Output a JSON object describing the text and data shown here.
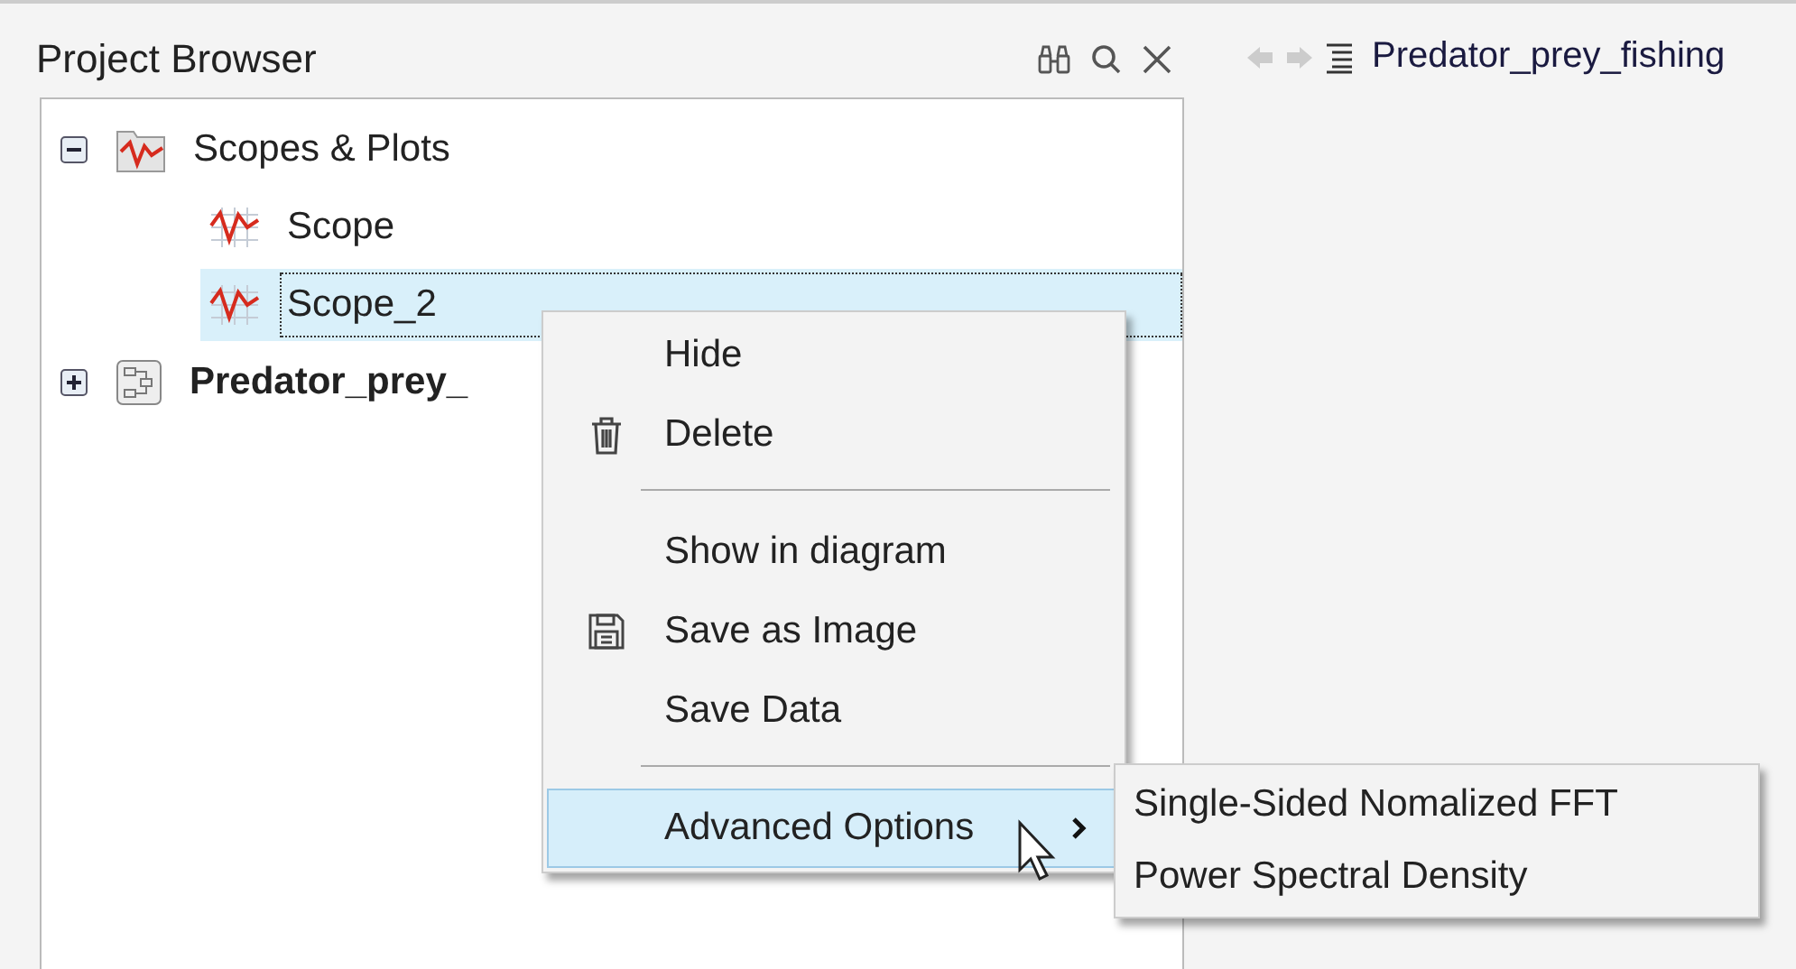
{
  "panel": {
    "title": "Project Browser"
  },
  "tree": [
    {
      "label": "Scopes & Plots",
      "kind": "folder",
      "expanded": true,
      "selected": false,
      "children": [
        {
          "label": "Scope",
          "kind": "scope",
          "selected": false
        },
        {
          "label": "Scope_2",
          "kind": "scope",
          "selected": true
        }
      ]
    },
    {
      "label": "Predator_prey_",
      "kind": "model",
      "expanded": false,
      "selected": false
    }
  ],
  "editor": {
    "breadcrumb": "Predator_prey_fishing"
  },
  "context_menu": [
    {
      "kind": "item",
      "label": "Hide",
      "selected": false
    },
    {
      "kind": "delete",
      "label": "Delete",
      "selected": false
    },
    {
      "kind": "separator"
    },
    {
      "kind": "item",
      "label": "Show in diagram",
      "selected": false
    },
    {
      "kind": "save",
      "label": "Save as Image",
      "selected": false
    },
    {
      "kind": "item",
      "label": "Save Data",
      "selected": false
    },
    {
      "kind": "separator"
    },
    {
      "kind": "submenu",
      "label": "Advanced Options",
      "selected": true
    }
  ],
  "submenu": [
    {
      "label": "Single-Sided Nomalized FFT",
      "selected": false
    },
    {
      "label": "Power Spectral Density",
      "selected": false
    }
  ]
}
